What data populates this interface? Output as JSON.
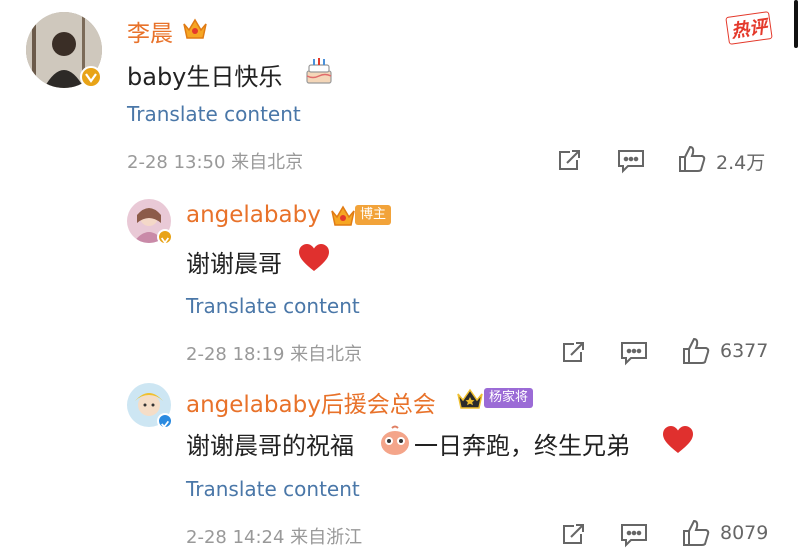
{
  "comments": [
    {
      "author": "李晨",
      "text": "baby生日快乐",
      "translate": "Translate content",
      "meta": "2-28 13:50 来自北京",
      "likes": "2.4万",
      "hot_label": "热评"
    },
    {
      "author": "angelababy",
      "tag": "博主",
      "text": "谢谢晨哥",
      "translate": "Translate content",
      "meta": "2-28 18:19 来自北京",
      "likes": "6377"
    },
    {
      "author": "angelababy后援会总会",
      "tag": "杨家将",
      "text_a": "谢谢晨哥的祝福",
      "text_b": "一日奔跑，终生兄弟",
      "translate": "Translate content",
      "meta": "2-28 14:24 来自浙江",
      "likes": "8079"
    }
  ],
  "icons": {
    "share": "share-icon",
    "comment": "comment-icon",
    "like": "thumbs-up-icon",
    "cake": "cake-emoji-icon",
    "heart": "heart-emoji-icon",
    "crown": "crown-icon"
  },
  "colors": {
    "name": "#e8722a",
    "translate": "#4a77a8",
    "meta": "#999999",
    "hot": "#e4392b",
    "heart": "#e0302e"
  }
}
